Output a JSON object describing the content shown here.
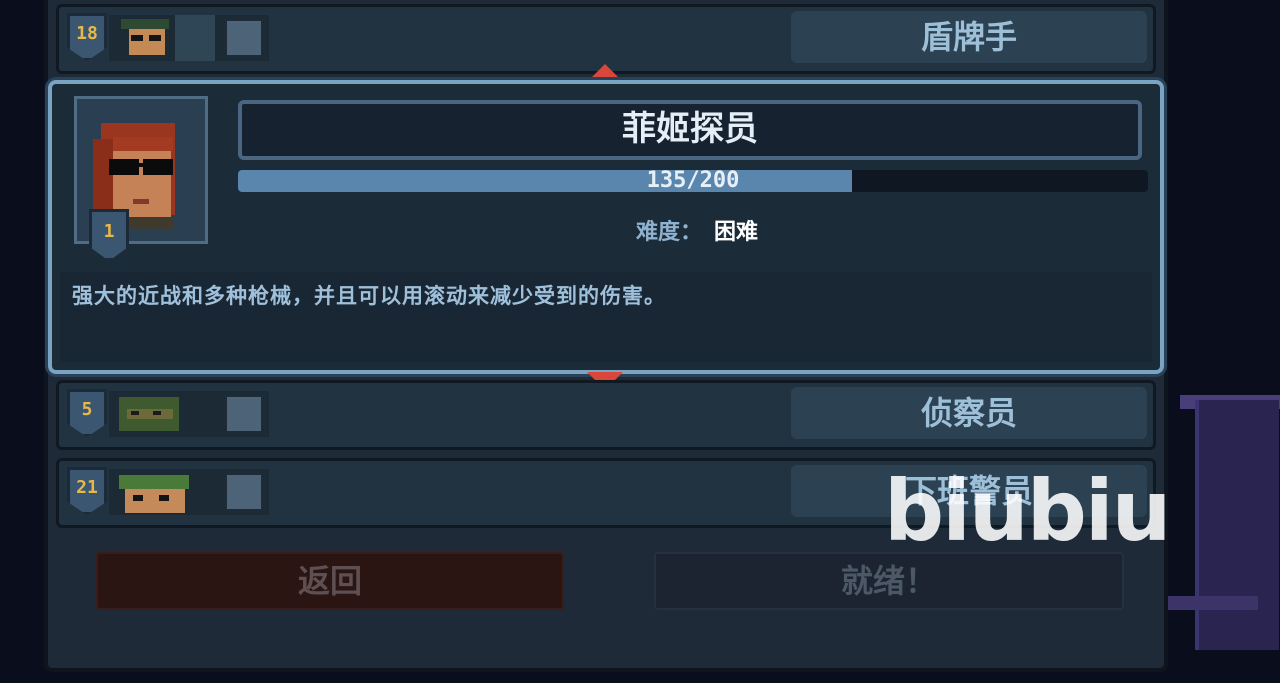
{
  "roster": {
    "above": {
      "level": "18",
      "name": "盾牌手"
    },
    "selected": {
      "level": "1",
      "name": "菲姬探员",
      "xp_text": "135/200",
      "xp_fraction": 0.675,
      "difficulty_label": "难度：",
      "difficulty_value": "困难",
      "description": "强大的近战和多种枪械，并且可以用滚动来减少受到的伤害。"
    },
    "below": [
      {
        "level": "5",
        "name": "侦察员"
      },
      {
        "level": "21",
        "name": "下班警员"
      }
    ]
  },
  "buttons": {
    "back": "返回",
    "ready": "就绪！"
  },
  "watermark": "biubiu",
  "colors": {
    "accent": "#7aa4c4",
    "arrow": "#d8473a",
    "level_gold": "#e8b84a",
    "xp_fill": "#5a86ad"
  },
  "icons": {
    "scroll_up": "triangle-up-icon",
    "scroll_down": "triangle-down-icon"
  }
}
